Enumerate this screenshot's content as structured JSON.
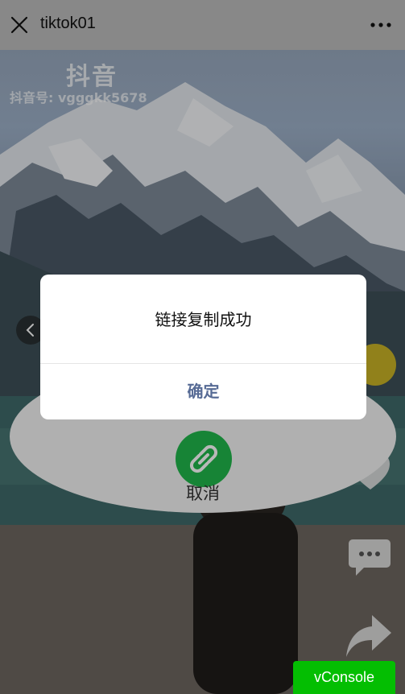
{
  "header": {
    "title": "tiktok01",
    "close_icon": "close-icon",
    "more_icon": "more-dots-icon"
  },
  "video": {
    "watermark_logo": "抖音",
    "watermark_id": "抖音号: vgggkk5678"
  },
  "share_sheet": {
    "copy_link_icon": "link-icon",
    "cancel_label": "取消"
  },
  "dialog": {
    "message": "链接复制成功",
    "confirm_label": "确定"
  },
  "debug": {
    "vconsole_label": "vConsole"
  },
  "colors": {
    "accent_green": "#20b84b",
    "dialog_button": "#576b95",
    "vconsole_green": "#04be02"
  }
}
